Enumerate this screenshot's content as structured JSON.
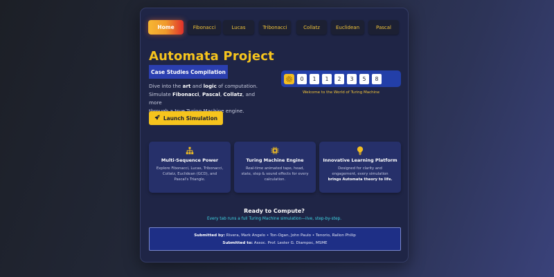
{
  "nav": {
    "items": [
      {
        "label": "Home",
        "active": true
      },
      {
        "label": "Fibonacci"
      },
      {
        "label": "Lucas"
      },
      {
        "label": "Tribonacci"
      },
      {
        "label": "Collatz"
      },
      {
        "label": "Euclidean"
      },
      {
        "label": "Pascal"
      }
    ]
  },
  "hero": {
    "title": "Automata Project",
    "subtitle": "Case Studies Compilation",
    "desc_line1_pre": "Dive into the ",
    "desc_bold1": "art",
    "desc_and": " and ",
    "desc_bold2": "logic",
    "desc_line1_post": " of computation.",
    "desc_line2_pre": "Simulate ",
    "desc_fib": "Fibonacci",
    "desc_sep1": ", ",
    "desc_pascal": "Pascal",
    "desc_sep2": ", ",
    "desc_collatz": "Collatz",
    "desc_line2_post": ", and more",
    "desc_line3": "through a true Turing Machine engine.",
    "launch_label": "Launch Simulation",
    "launch_icon": "rocket-icon"
  },
  "tape": {
    "head_icon": "gear-icon",
    "cells": [
      "0",
      "1",
      "1",
      "2",
      "3",
      "5",
      "8"
    ],
    "caption": "Welcome to the World of Turing Machine"
  },
  "features": [
    {
      "icon": "sitemap-icon",
      "title": "Multi-Sequence Power",
      "text": "Explore Fibonacci, Lucas, Tribonacci, Collatz, Euclidean (GCD), and Pascal's Triangle."
    },
    {
      "icon": "microchip-icon",
      "title": "Turing Machine Engine",
      "text": "Real-time animated tape, head, state, step & sound effects for every calculation."
    },
    {
      "icon": "lightbulb-icon",
      "title": "Innovative Learning Platform",
      "text_pre": "Designed for clarity and engagement, every simulation ",
      "text_bold": "brings Automata theory to life.",
      "text": ""
    }
  ],
  "ready": {
    "title": "Ready to Compute?",
    "subtitle": "Every tab runs a full Turing Machine simulation—live, step-by-step."
  },
  "credits": {
    "by_label": "Submitted by:",
    "by_value": " Rivera, Mark Angelo • Ton-Ogan, John Paulo • Tenorio, Rallon Philip",
    "to_label": "Submitted to:",
    "to_value": " Assoc. Prof. Lester G. Diampoc, MSME"
  },
  "colors": {
    "accent": "#f6c41d",
    "card_bg": "#1f2546",
    "tape_bg": "#233fa8",
    "link_cyan": "#3fd8e6"
  }
}
